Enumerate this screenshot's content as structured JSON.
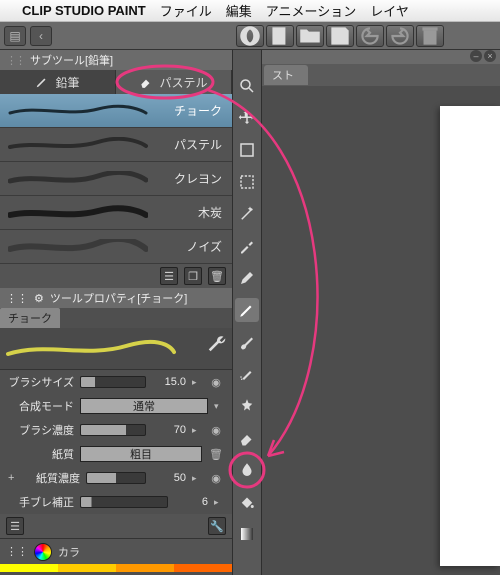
{
  "menu": {
    "app": "CLIP STUDIO PAINT",
    "items": [
      "ファイル",
      "編集",
      "アニメーション",
      "レイヤ"
    ]
  },
  "subtool_panel": {
    "title": "サブツール[鉛筆]",
    "tabs": [
      {
        "icon": "pencil",
        "label": "鉛筆"
      },
      {
        "icon": "eraser-tip",
        "label": "パステル"
      }
    ],
    "active_tab": 1,
    "brushes": [
      "チョーク",
      "パステル",
      "クレヨン",
      "木炭",
      "ノイズ"
    ],
    "selected_brush": 0
  },
  "toolprop": {
    "title": "ツールプロパティ[チョーク]",
    "tab": "チョーク",
    "rows": [
      {
        "label": "ブラシサイズ",
        "value": "15.0",
        "fill": 22,
        "extra": "link"
      },
      {
        "label": "合成モード",
        "mode": "通常"
      },
      {
        "label": "ブラシ濃度",
        "value": "70",
        "fill": 70,
        "extra": "link"
      },
      {
        "label": "紙質",
        "mode": "粗目",
        "extra": "trash"
      },
      {
        "label": "紙質濃度",
        "value": "50",
        "fill": 50,
        "extra": "link",
        "prefix": "+"
      },
      {
        "label": "手ブレ補正",
        "value": "6",
        "fill": 12
      }
    ]
  },
  "color_panel": {
    "label": "カラ"
  },
  "doc": {
    "tab": "スト",
    "rightlabel": "イラスト"
  },
  "annot_color": "#e6397f"
}
